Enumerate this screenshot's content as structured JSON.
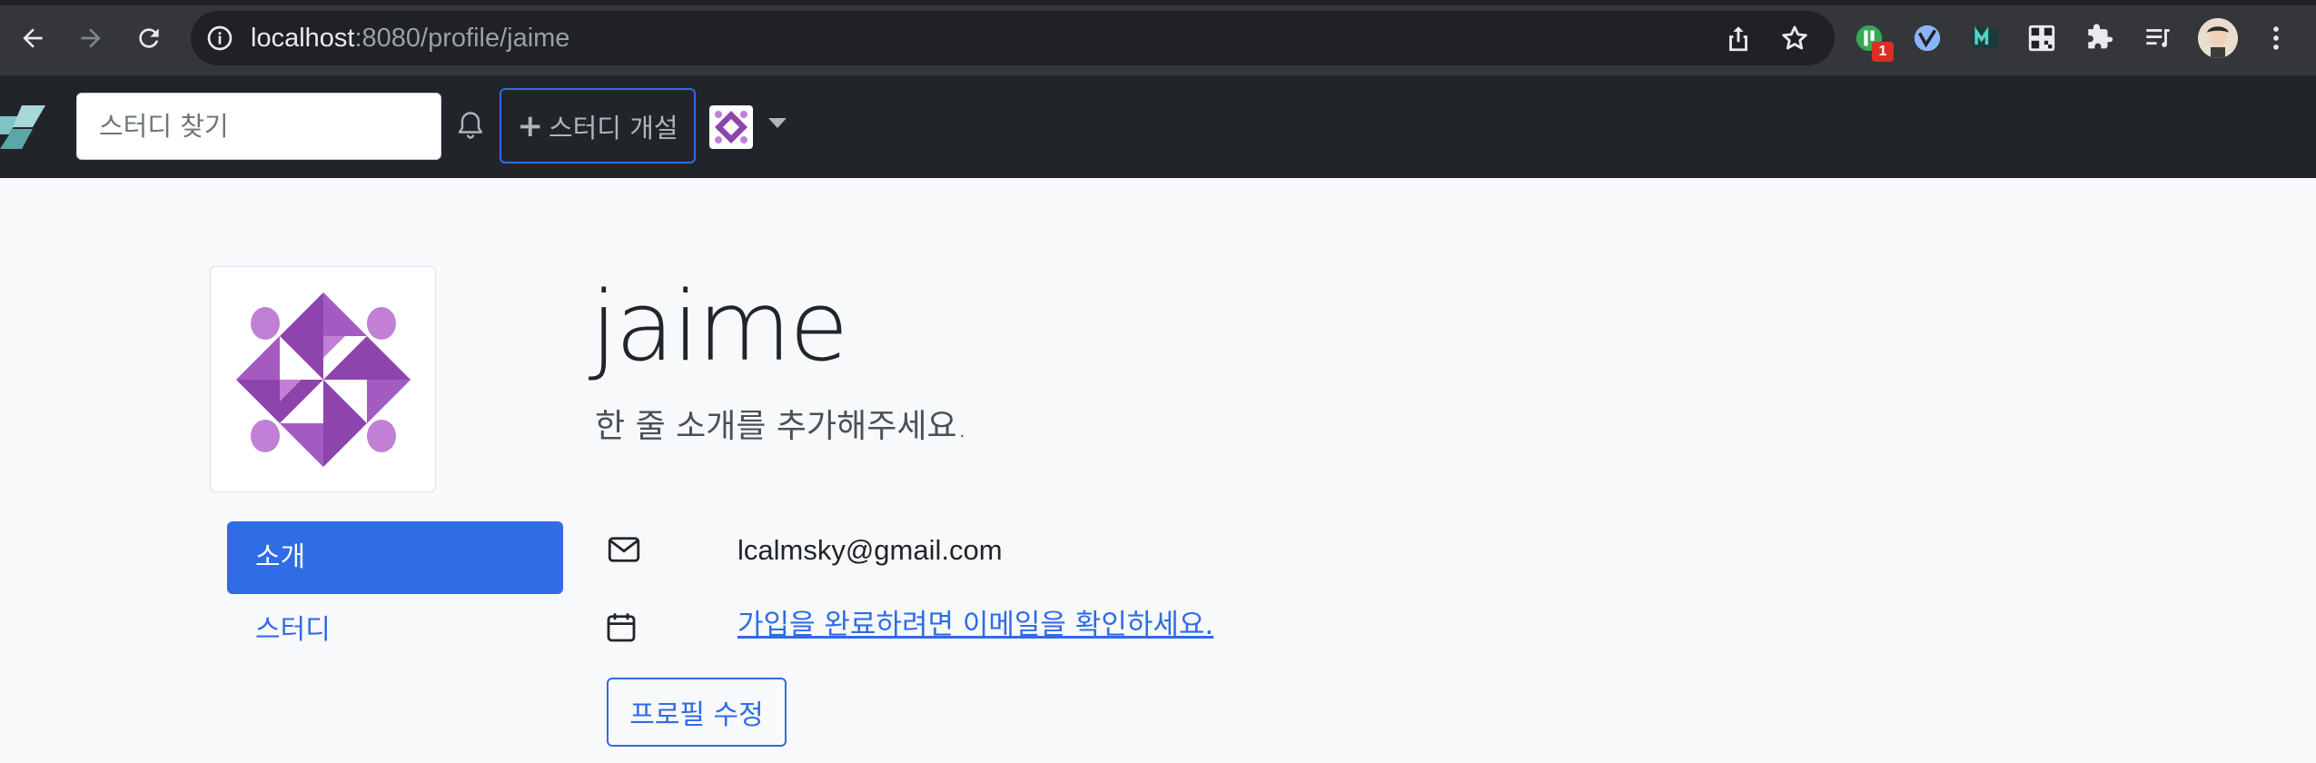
{
  "browser": {
    "url_host": "localhost",
    "url_path": ":8080/profile/jaime",
    "extension_badge": "1"
  },
  "navbar": {
    "search_placeholder": "스터디 찾기",
    "new_study_label": "스터디 개설"
  },
  "profile": {
    "username": "jaime",
    "bio": "한 줄 소개를 추가해주세요.",
    "email": "lcalmsky@gmail.com",
    "verify_email_link": "가입을 완료하려면 이메일을 확인하세요.",
    "edit_button": "프로필 수정"
  },
  "tabs": [
    {
      "label": "소개",
      "active": true
    },
    {
      "label": "스터디",
      "active": false
    }
  ],
  "colors": {
    "primary": "#2f6ce5",
    "navbar_bg": "#212529",
    "page_bg": "#f8f9fa",
    "identicon": "#8e44ad"
  },
  "icons": [
    "back-icon",
    "forward-icon",
    "reload-icon",
    "info-icon",
    "share-icon",
    "star-icon",
    "bell-icon",
    "envelope-icon",
    "calendar-icon",
    "extensions-icon",
    "menu-icon"
  ]
}
